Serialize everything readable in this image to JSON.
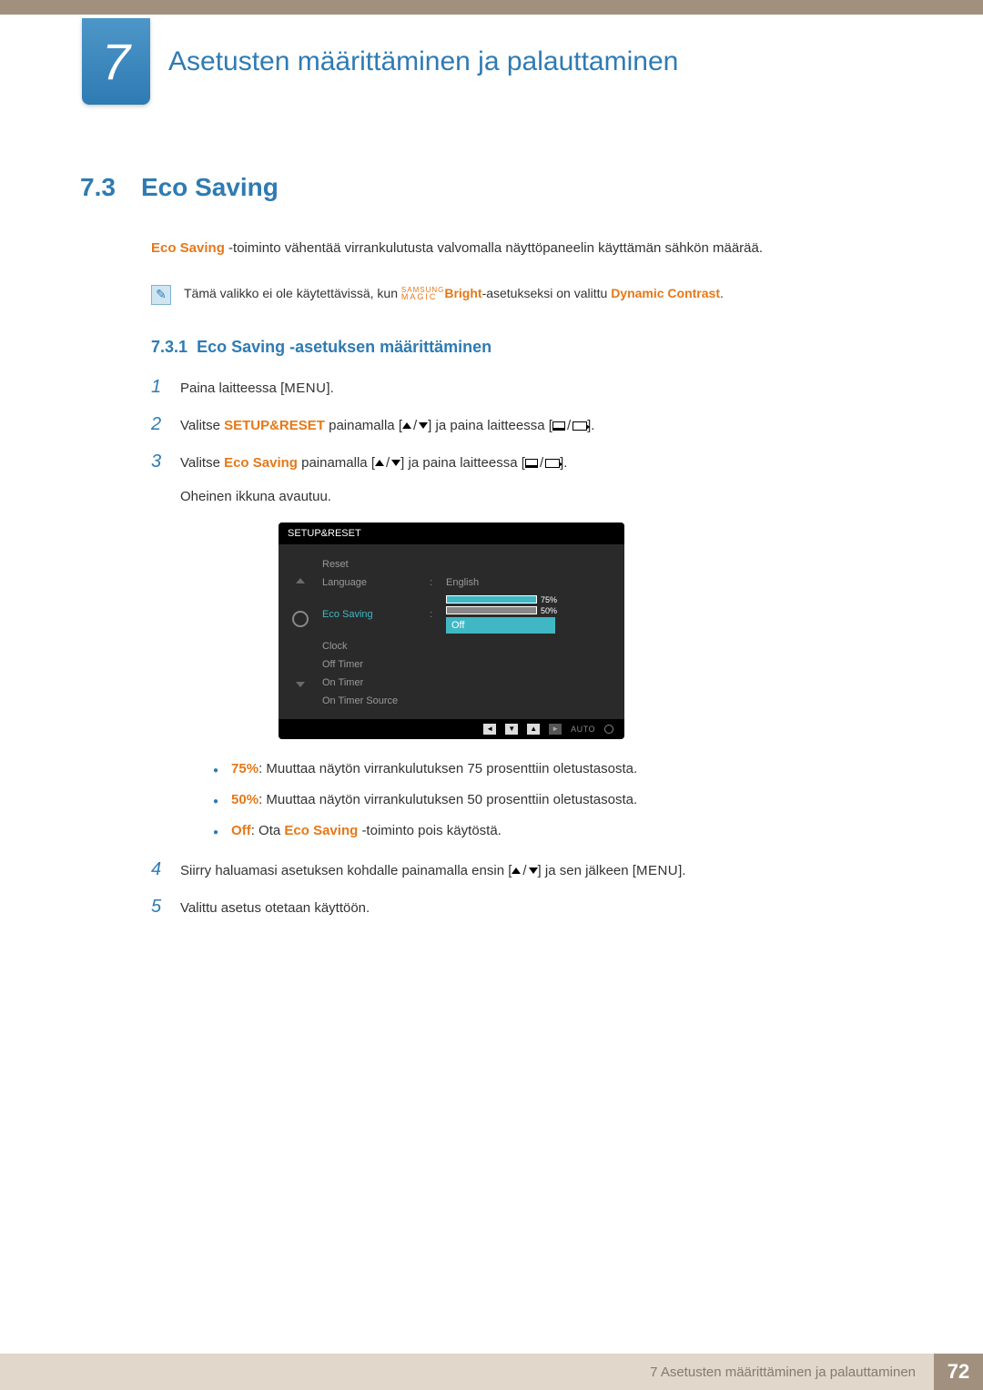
{
  "chapter": {
    "number": "7",
    "title": "Asetusten määrittäminen ja palauttaminen"
  },
  "section": {
    "number": "7.3",
    "title": "Eco Saving"
  },
  "intro": {
    "lead_orange": "Eco Saving ",
    "lead_rest": "-toiminto vähentää virrankulutusta valvomalla näyttöpaneelin käyttämän sähkön määrää."
  },
  "note": {
    "before": "Tämä valikko ei ole käytettävissä, kun ",
    "magic_top": "SAMSUNG",
    "magic_bot": "MAGIC",
    "bright": "Bright",
    "mid": "-asetukseksi on valittu ",
    "dynamic": "Dynamic Contrast",
    "end": "."
  },
  "subsection": {
    "number": "7.3.1",
    "title": "Eco Saving -asetuksen määrittäminen"
  },
  "steps": {
    "s1": {
      "n": "1",
      "t1": "Paina laitteessa [",
      "menu": "MENU",
      "t2": "]."
    },
    "s2": {
      "n": "2",
      "t1": "Valitse ",
      "setup": "SETUP&RESET",
      "t2": " painamalla [",
      "t3": "] ja paina laitteessa [",
      "t4": "]."
    },
    "s3": {
      "n": "3",
      "t1": "Valitse ",
      "eco": "Eco Saving",
      "t2": " painamalla [",
      "t3": "] ja paina laitteessa [",
      "t4": "]."
    },
    "s3sub": "Oheinen ikkuna avautuu.",
    "s4": {
      "n": "4",
      "t1": "Siirry haluamasi asetuksen kohdalle painamalla ensin [",
      "t2": "] ja sen jälkeen [",
      "menu": "MENU",
      "t3": "]."
    },
    "s5": {
      "n": "5",
      "t1": "Valittu asetus otetaan käyttöön."
    }
  },
  "bullets": {
    "b1": {
      "label": "75%",
      "text": ": Muuttaa näytön virrankulutuksen 75 prosenttiin oletustasosta."
    },
    "b2": {
      "label": "50%",
      "text": ": Muuttaa näytön virrankulutuksen 50 prosenttiin oletustasosta."
    },
    "b3": {
      "label": "Off",
      "mid": ": Ota ",
      "eco": "Eco Saving ",
      "text": "-toiminto pois käytöstä."
    }
  },
  "osd": {
    "header": "SETUP&RESET",
    "items": {
      "reset": "Reset",
      "language": "Language",
      "language_val": "English",
      "eco": "Eco Saving",
      "bar75": "75%",
      "bar50": "50%",
      "off": "Off",
      "clock": "Clock",
      "offtimer": "Off Timer",
      "ontimer": "On Timer",
      "ontimersrc": "On Timer Source"
    },
    "auto": "AUTO"
  },
  "footer": {
    "text": "7 Asetusten määrittäminen ja palauttaminen",
    "page": "72"
  }
}
